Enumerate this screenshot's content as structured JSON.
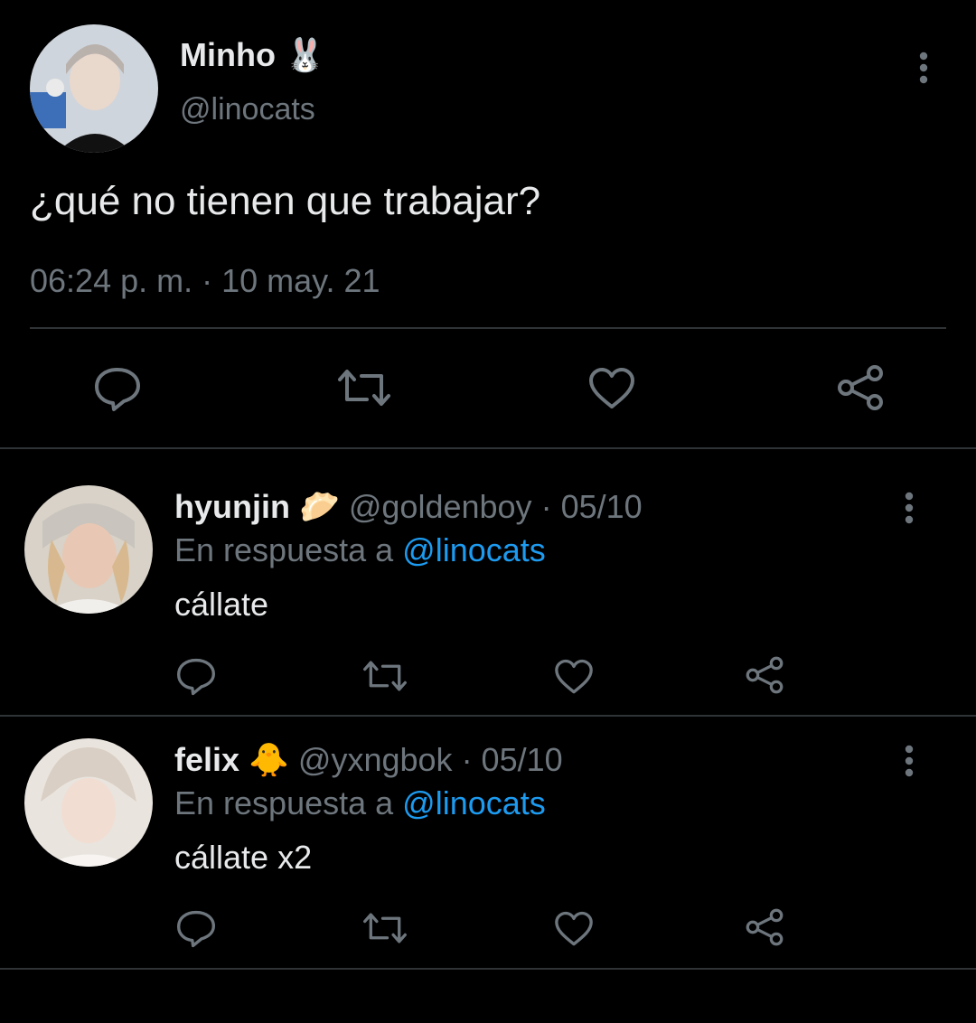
{
  "main_tweet": {
    "display_name": "Minho",
    "name_emoji": "🐰",
    "handle": "@linocats",
    "text": "¿qué no tienen que trabajar?",
    "timestamp": "06:24 p. m. · 10 may. 21"
  },
  "replies": [
    {
      "display_name": "hyunjin",
      "name_emoji": "🥟",
      "handle": "@goldenboy",
      "date": "· 05/10",
      "reply_prefix": "En respuesta a",
      "reply_to": "@linocats",
      "text": "cállate"
    },
    {
      "display_name": "felix",
      "name_emoji": "🐥",
      "handle": "@yxngbok",
      "date": "· 05/10",
      "reply_prefix": "En respuesta a",
      "reply_to": "@linocats",
      "text": "cállate x2"
    }
  ],
  "icons": [
    "more-icon",
    "reply-icon",
    "retweet-icon",
    "like-icon",
    "share-icon"
  ],
  "colors": {
    "background": "#000000",
    "text": "#e7e9ea",
    "muted": "#6e767d",
    "link": "#1d9bf0",
    "divider": "#2f3336"
  }
}
